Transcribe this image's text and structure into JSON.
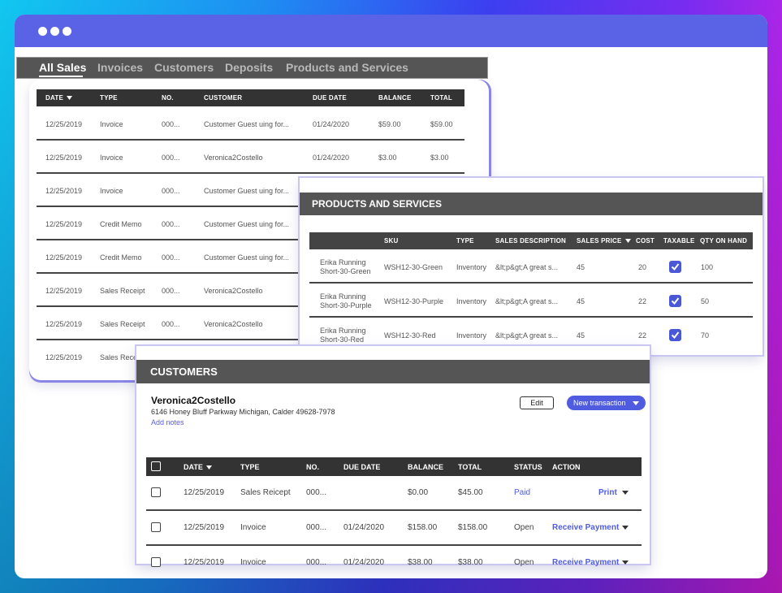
{
  "colors": {
    "accent": "#5a63e6",
    "header_dark": "#333333",
    "link": "#4f5ce0"
  },
  "window": {
    "dots": [
      "dot",
      "dot",
      "dot"
    ]
  },
  "tabs": [
    {
      "label": "All Sales",
      "active": true
    },
    {
      "label": "Invoices",
      "active": false
    },
    {
      "label": "Customers",
      "active": false
    },
    {
      "label": "Deposits",
      "active": false
    },
    {
      "label": "Products and Services",
      "active": false
    }
  ],
  "sales": {
    "columns": [
      "DATE",
      "TYPE",
      "NO.",
      "CUSTOMER",
      "DUE DATE",
      "BALANCE",
      "TOTAL"
    ],
    "rows": [
      {
        "date": "12/25/2019",
        "type": "Invoice",
        "no": "000...",
        "customer": "Customer Guest uing for...",
        "due": "01/24/2020",
        "balance": "$59.00",
        "total": "$59.00"
      },
      {
        "date": "12/25/2019",
        "type": "Invoice",
        "no": "000...",
        "customer": "Veronica2Costello",
        "due": "01/24/2020",
        "balance": "$3.00",
        "total": "$3.00"
      },
      {
        "date": "12/25/2019",
        "type": "Invoice",
        "no": "000...",
        "customer": "Customer Guest uing for...",
        "due": "",
        "balance": "",
        "total": ""
      },
      {
        "date": "12/25/2019",
        "type": "Credit Memo",
        "no": "000...",
        "customer": "Customer Guest uing for...",
        "due": "",
        "balance": "",
        "total": ""
      },
      {
        "date": "12/25/2019",
        "type": "Credit Memo",
        "no": "000...",
        "customer": "Customer Guest uing for...",
        "due": "",
        "balance": "",
        "total": ""
      },
      {
        "date": "12/25/2019",
        "type": "Sales Receipt",
        "no": "000...",
        "customer": "Veronica2Costello",
        "due": "",
        "balance": "",
        "total": ""
      },
      {
        "date": "12/25/2019",
        "type": "Sales Receipt",
        "no": "000...",
        "customer": "Veronica2Costello",
        "due": "",
        "balance": "",
        "total": ""
      },
      {
        "date": "12/25/2019",
        "type": "Sales Rece",
        "no": "",
        "customer": "",
        "due": "",
        "balance": "",
        "total": ""
      }
    ]
  },
  "products": {
    "title": "PRODUCTS AND SERVICES",
    "columns": [
      "SKU",
      "TYPE",
      "SALES DESCRIPTION",
      "SALES PRICE",
      "COST",
      "TAXABLE",
      "QTY ON HAND"
    ],
    "rows": [
      {
        "name1": "Erika Running",
        "name2": "Short-30-Green",
        "sku": "WSH12-30-Green",
        "type": "Inventory",
        "desc": "&lt;p&gt;A great s...",
        "price": "45",
        "cost": "20",
        "qty": "100"
      },
      {
        "name1": "Erika Running",
        "name2": "Short-30-Purple",
        "sku": "WSH12-30-Purple",
        "type": "Inventory",
        "desc": "&lt;p&gt;A great s...",
        "price": "45",
        "cost": "22",
        "qty": "50"
      },
      {
        "name1": "Erika Running",
        "name2": "Short-30-Red",
        "sku": "WSH12-30-Red",
        "type": "Inventory",
        "desc": "&lt;p&gt;A great s...",
        "price": "45",
        "cost": "22",
        "qty": "70"
      }
    ]
  },
  "customers": {
    "title": "CUSTOMERS",
    "name": "Veronica2Costello",
    "address": "6146 Honey Bluff Parkway Michigan, Calder 49628-7978",
    "add_notes": "Add notes",
    "edit_label": "Edit",
    "new_transaction_label": "New transaction",
    "columns": [
      "DATE",
      "TYPE",
      "NO.",
      "DUE DATE",
      "BALANCE",
      "TOTAL",
      "STATUS",
      "ACTION"
    ],
    "rows": [
      {
        "date": "12/25/2019",
        "type": "Sales Reicept",
        "no": "000...",
        "due": "",
        "balance": "$0.00",
        "total": "$45.00",
        "status": "Paid",
        "action": "Print"
      },
      {
        "date": "12/25/2019",
        "type": "Invoice",
        "no": "000...",
        "due": "01/24/2020",
        "balance": "$158.00",
        "total": "$158.00",
        "status": "Open",
        "action": "Receive Payment"
      },
      {
        "date": "12/25/2019",
        "type": "Invoice",
        "no": "000...",
        "due": "01/24/2020",
        "balance": "$38.00",
        "total": "$38.00",
        "status": "Open",
        "action": "Receive Payment"
      }
    ]
  }
}
